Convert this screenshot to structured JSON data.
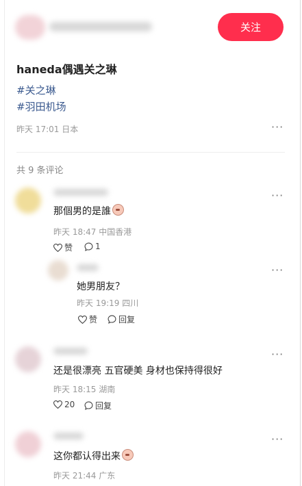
{
  "header": {
    "follow_label": "关注"
  },
  "post": {
    "title": "haneda偶遇关之琳",
    "tags": [
      "#关之琳",
      "#羽田机场"
    ],
    "meta": "昨天 17:01 日本"
  },
  "comments_count": "共 9 条评论",
  "comments": [
    {
      "text": "那個男的是誰",
      "meta": "昨天 18:47 中国香港",
      "like_label": "赞",
      "reply_count": "1",
      "replies": [
        {
          "text": "她男朋友？",
          "meta": "昨天 19:19 四川",
          "like_label": "赞",
          "reply_label": "回复"
        }
      ]
    },
    {
      "text": "还是很漂亮 五官硬美 身材也保持得很好",
      "meta": "昨天 18:15 湖南",
      "like_count": "20",
      "reply_label": "回复"
    },
    {
      "text": "这你都认得出来",
      "meta": "昨天 21:44 广东"
    }
  ],
  "icons": [
    "heart-icon",
    "comment-icon",
    "more-icon",
    "emoji-icon"
  ],
  "colors": {
    "accent": "#ff2e4d",
    "tag": "#3b5a8f",
    "meta": "#999999"
  }
}
